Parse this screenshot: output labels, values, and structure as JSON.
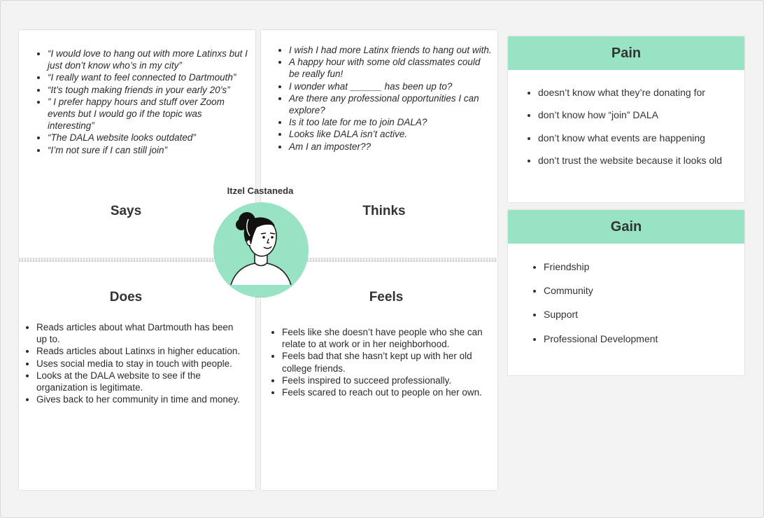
{
  "persona": {
    "name": "Itzel Castaneda"
  },
  "says": {
    "title": "Says",
    "items": [
      "“I would love to hang out with more Latinxs but I just don’t know who’s in my city”",
      "“I really want to feel connected to Dartmouth”",
      "“It’s tough making friends in your early 20’s”",
      "” I prefer happy hours and stuff over Zoom events but I would go if the topic was interesting”",
      "“The DALA website looks outdated”",
      "“I’m not sure if I can still join”"
    ]
  },
  "thinks": {
    "title": "Thinks",
    "items": [
      "I wish I had more Latinx friends to hang out with.",
      "A happy hour with some old classmates could be really fun!",
      "I wonder what ______ has been up to?",
      "Are there any professional opportunities I can explore?",
      "Is it too late for me to join DALA?",
      "Looks like DALA isn’t active.",
      "Am I an imposter??"
    ]
  },
  "does": {
    "title": "Does",
    "items": [
      "Reads articles about what Dartmouth has been up to.",
      "Reads articles about Latinxs in higher education.",
      "Uses social media to stay in touch with people.",
      "Looks at the DALA website to see if the organization is legitimate.",
      "Gives back to her community in time and money."
    ]
  },
  "feels": {
    "title": "Feels",
    "items": [
      "Feels like she doesn’t have people who she can relate to at work or in her neighborhood.",
      "Feels bad that she hasn’t kept up with her old college friends.",
      "Feels inspired to succeed professionally.",
      "Feels scared to reach out to people on her own."
    ]
  },
  "pain": {
    "title": "Pain",
    "items": [
      "doesn’t know what they’re donating for",
      "don’t know how “join” DALA",
      "don’t know what events are happening",
      "don’t trust the website because it looks old"
    ]
  },
  "gain": {
    "title": "Gain",
    "items": [
      "Friendship",
      "Community",
      "Support",
      "Professional Development"
    ]
  },
  "colors": {
    "accent": "#97e3c3",
    "card": "#ffffff",
    "background": "#f3f3f3"
  },
  "icons": {
    "avatar": "persona-avatar-illustration"
  }
}
